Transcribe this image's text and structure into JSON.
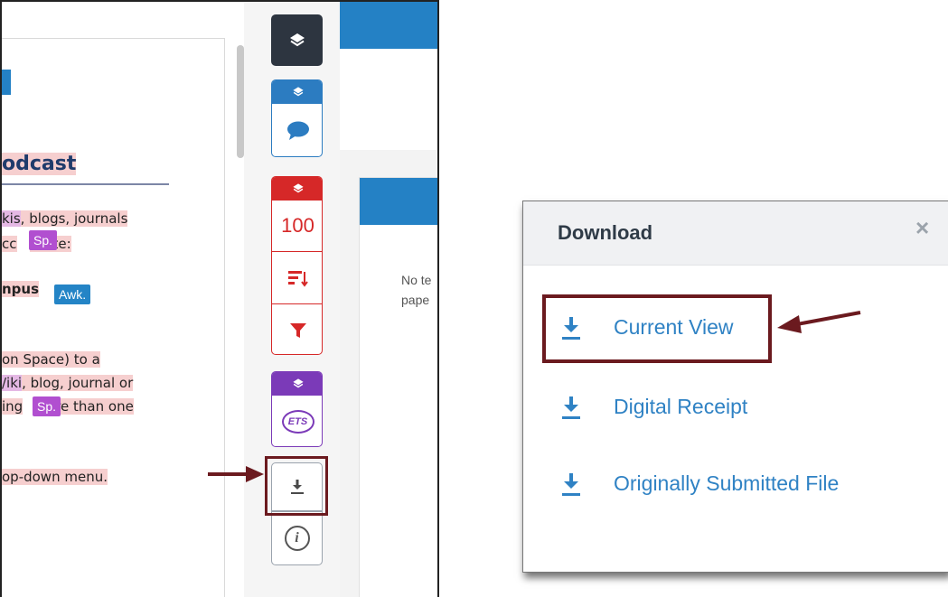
{
  "document": {
    "heading": "odcast",
    "lines": [
      {
        "a": "kis",
        "b": ", blogs, journals"
      },
      {
        "a": "cc",
        "b": "e site:"
      },
      {
        "a": "npus",
        "b": ""
      },
      {
        "a": "on Space) to a",
        "b": ""
      },
      {
        "a": "/iki",
        "b": ", blog, journal or"
      },
      {
        "a": "ing",
        "b": "re than one"
      },
      {
        "a": "op-down menu.",
        "b": ""
      }
    ],
    "badges": {
      "sp1": "Sp.",
      "awk": "Awk.",
      "sp2": "Sp."
    }
  },
  "toolbar": {
    "score": "100",
    "ets_label": "ETS",
    "info_label": "i",
    "icons": [
      "layers-icon",
      "comment-icon",
      "sort-icon",
      "filter-icon",
      "download-icon",
      "info-icon"
    ]
  },
  "background_panel": {
    "line1": "No te",
    "line2": "pape"
  },
  "dialog": {
    "title": "Download",
    "close": "×",
    "items": [
      "Current View",
      "Digital Receipt",
      "Originally Submitted File"
    ]
  },
  "colors": {
    "accent_blue": "#2c7cc1",
    "red": "#d62828",
    "purple": "#7b3ab8",
    "dark": "#2d3540",
    "highlight_box": "#6b1a1f"
  }
}
